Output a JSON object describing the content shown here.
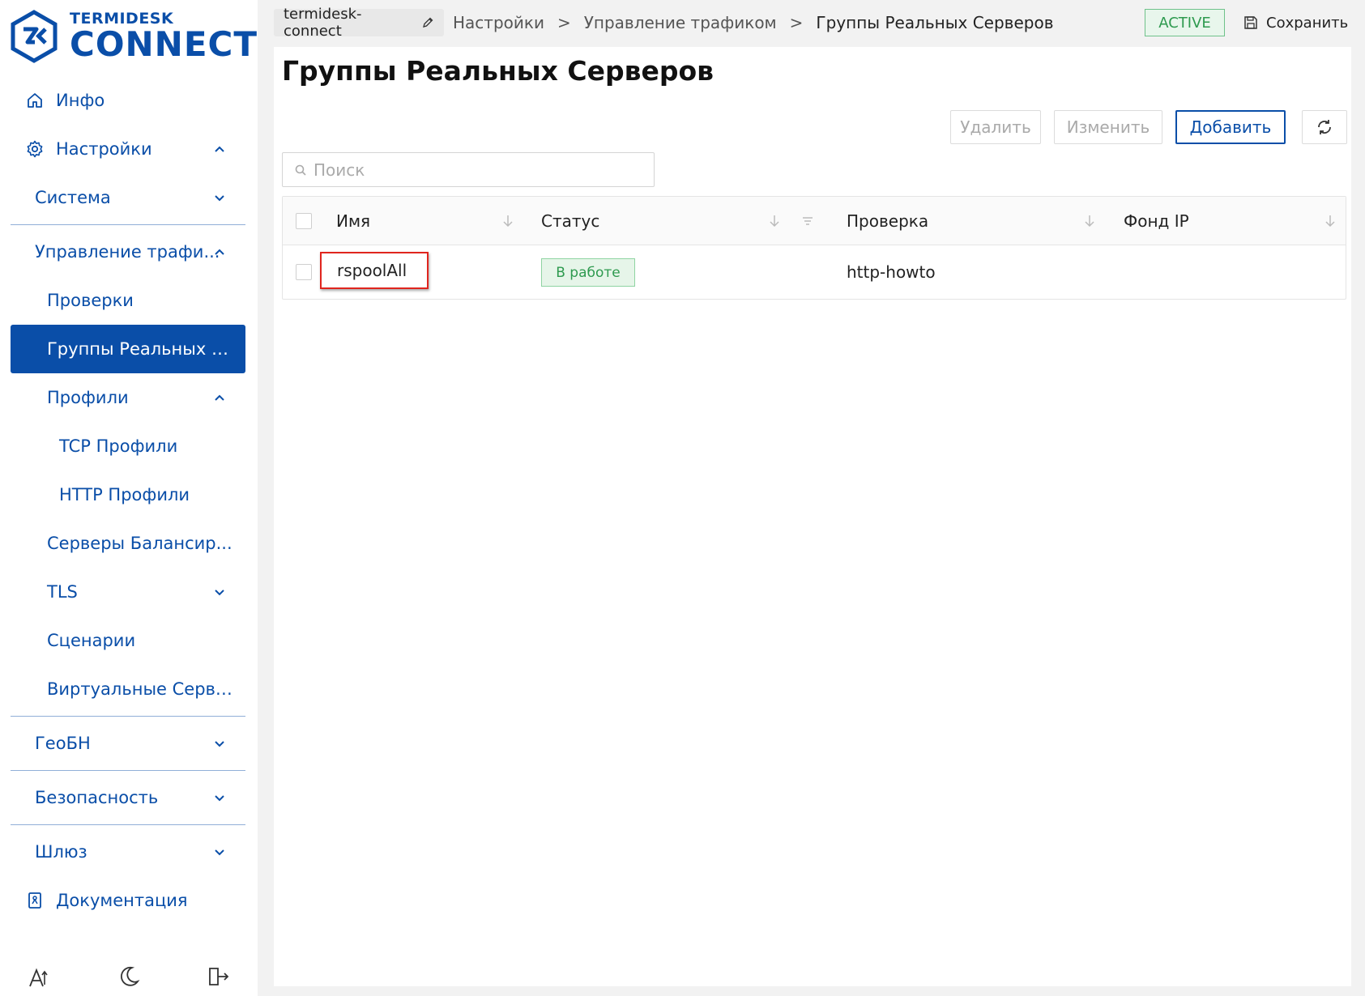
{
  "brand": {
    "top": "TERMIDESK",
    "main": "CONNECT"
  },
  "sidebar": {
    "items": [
      {
        "label": "Инфо"
      },
      {
        "label": "Настройки"
      },
      {
        "label": "Система"
      },
      {
        "label": "Управление трафи..."
      },
      {
        "label": "Проверки"
      },
      {
        "label": "Группы Реальных С..."
      },
      {
        "label": "Профили"
      },
      {
        "label": "TCP Профили"
      },
      {
        "label": "HTTP Профили"
      },
      {
        "label": "Серверы Балансир..."
      },
      {
        "label": "TLS"
      },
      {
        "label": "Сценарии"
      },
      {
        "label": "Виртуальные Серве..."
      },
      {
        "label": "ГеоБН"
      },
      {
        "label": "Безопасность"
      },
      {
        "label": "Шлюз"
      },
      {
        "label": "Документация"
      }
    ]
  },
  "topbar": {
    "instance": "termidesk-connect",
    "breadcrumbs": [
      "Настройки",
      "Управление трафиком",
      "Группы Реальных Серверов"
    ],
    "separator": ">",
    "status": "ACTIVE",
    "save_label": "Сохранить"
  },
  "main": {
    "title": "Группы Реальных Серверов",
    "buttons": {
      "delete": "Удалить",
      "edit": "Изменить",
      "add": "Добавить"
    },
    "search_placeholder": "Поиск",
    "table": {
      "columns": [
        "Имя",
        "Статус",
        "Проверка",
        "Фонд IP"
      ],
      "rows": [
        {
          "name": "rspoolAll",
          "status": "В работе",
          "check": "http-howto",
          "ip_pool": ""
        }
      ]
    }
  },
  "colors": {
    "accent": "#0a4ea8",
    "active_green": "#2e9a4f",
    "highlight_red": "#e0251e"
  }
}
